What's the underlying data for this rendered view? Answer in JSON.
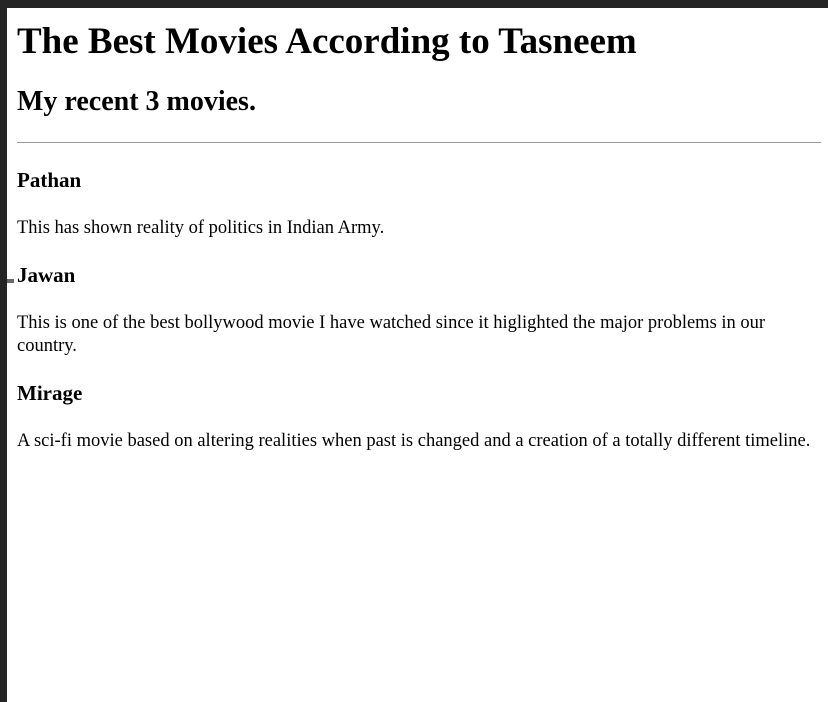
{
  "page": {
    "title": "The Best Movies According to Tasneem",
    "subtitle": "My recent 3 movies."
  },
  "movies": [
    {
      "title": "Pathan",
      "description": "This has shown reality of politics in Indian Army."
    },
    {
      "title": "Jawan",
      "description": "This is one of the best bollywood movie I have watched since it higlighted the major problems in our country."
    },
    {
      "title": "Mirage",
      "description": "A sci-fi movie based on altering realities when past is changed and a creation of a totally different timeline."
    }
  ]
}
